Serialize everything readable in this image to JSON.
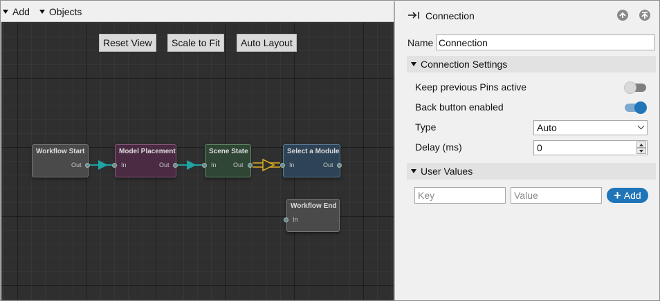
{
  "editor": {
    "toolbar": {
      "add_label": "Add",
      "objects_label": "Objects"
    },
    "view_buttons": {
      "reset": "Reset View",
      "scale": "Scale to Fit",
      "layout": "Auto Layout"
    },
    "nodes": {
      "workflow_start": {
        "title": "Workflow Start",
        "out": "Out",
        "color": "#4a4a4a"
      },
      "model_placement": {
        "title": "Model Placement",
        "in": "In",
        "out": "Out",
        "color": "#4b2a43"
      },
      "scene_state": {
        "title": "Scene State",
        "in": "In",
        "out": "Out",
        "color": "#2f4634"
      },
      "select_module": {
        "title": "Select a Module",
        "in": "In",
        "out": "Out",
        "color": "#2e4355"
      },
      "workflow_end": {
        "title": "Workflow End",
        "in": "In",
        "color": "#4a4a4a"
      }
    },
    "colors": {
      "link": "#1fa3a3",
      "selected_link": "#e0b020"
    }
  },
  "inspector": {
    "title": "Connection",
    "icons": {
      "header": "arrow-into-icon",
      "up": "arrow-up-icon",
      "top": "arrow-top-icon"
    },
    "name_label": "Name",
    "name_value": "Connection",
    "connection_settings": {
      "header": "Connection Settings",
      "keep_pins_label": "Keep previous Pins active",
      "keep_pins_on": false,
      "back_button_label": "Back button enabled",
      "back_button_on": true,
      "type_label": "Type",
      "type_value": "Auto",
      "delay_label": "Delay (ms)",
      "delay_value": "0"
    },
    "user_values": {
      "header": "User Values",
      "key_placeholder": "Key",
      "value_placeholder": "Value",
      "add_label": "Add"
    },
    "accent_color": "#1f75b8"
  }
}
